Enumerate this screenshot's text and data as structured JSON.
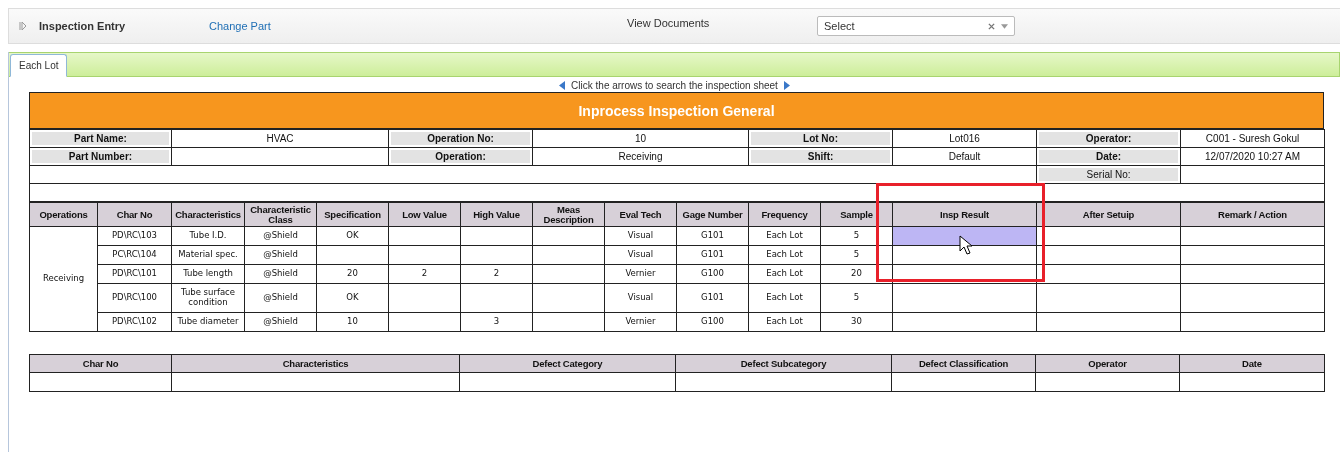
{
  "toolbar": {
    "title": "Inspection Entry",
    "link": "Change Part",
    "documents_label": "View Documents",
    "select": {
      "value": "Select"
    }
  },
  "tabs": [
    {
      "label": "Each Lot",
      "selected": true
    }
  ],
  "hint": "Click the arrows to search the inspection sheet",
  "sheet_title": "Inprocess Inspection General",
  "info_rows": [
    [
      {
        "label": "Part Name:",
        "value": "HVAC"
      },
      {
        "label": "Operation No:",
        "value": "10"
      },
      {
        "label": "Lot No:",
        "value": "Lot016"
      },
      {
        "label": "Operator:",
        "value": "C001 - Suresh Gokul"
      }
    ],
    [
      {
        "label": "Part Number:"
      },
      {
        "label": "Operation:",
        "value": "Receiving"
      },
      {
        "label": "Shift:",
        "value": "Default"
      },
      {
        "label": "Date:",
        "value": "12/07/2020 10:27 AM"
      }
    ]
  ],
  "serial_label": "Serial No:",
  "columns": [
    "Operations",
    "Char No",
    "Characteristics",
    "Characteristic Class",
    "Specification",
    "Low Value",
    "High Value",
    "Meas Description",
    "Eval Tech",
    "Gage Number",
    "Frequency",
    "Sample",
    "Insp Result",
    "After Setuip",
    "Remark / Action"
  ],
  "operation": "Receiving",
  "rows": [
    {
      "char_no": "PD\\RC\\103",
      "characteristic": "Tube I.D.",
      "class": "@Shield",
      "specification": "OK",
      "low": "",
      "high": "",
      "meas": "",
      "eval": "Visual",
      "gage": "G101",
      "frequency": "Each Lot",
      "sample": "5",
      "selected": true
    },
    {
      "char_no": "PC\\RC\\104",
      "characteristic": "Material spec.",
      "class": "@Shield",
      "specification": "",
      "low": "",
      "high": "",
      "meas": "",
      "eval": "Visual",
      "gage": "G101",
      "frequency": "Each Lot",
      "sample": "5",
      "selected": false
    },
    {
      "char_no": "PD\\RC\\101",
      "characteristic": "Tube length",
      "class": "@Shield",
      "specification": "20",
      "low": "2",
      "high": "2",
      "meas": "",
      "eval": "Vernier",
      "gage": "G100",
      "frequency": "Each Lot",
      "sample": "20",
      "selected": false
    },
    {
      "char_no": "PD\\RC\\100",
      "characteristic": "Tube surface condition",
      "class": "@Shield",
      "specification": "OK",
      "low": "",
      "high": "",
      "meas": "",
      "eval": "Visual",
      "gage": "G101",
      "frequency": "Each Lot",
      "sample": "5",
      "selected": false
    },
    {
      "char_no": "PD\\RC\\102",
      "characteristic": "Tube diameter",
      "class": "@Shield",
      "specification": "10",
      "low": "",
      "high": "3",
      "meas": "",
      "eval": "Vernier",
      "gage": "G100",
      "frequency": "Each Lot",
      "sample": "30",
      "selected": false
    }
  ],
  "defect_columns": [
    "Char No",
    "Characteristics",
    "Defect Category",
    "Defect Subcategory",
    "Defect Classification",
    "Operator",
    "Date"
  ]
}
